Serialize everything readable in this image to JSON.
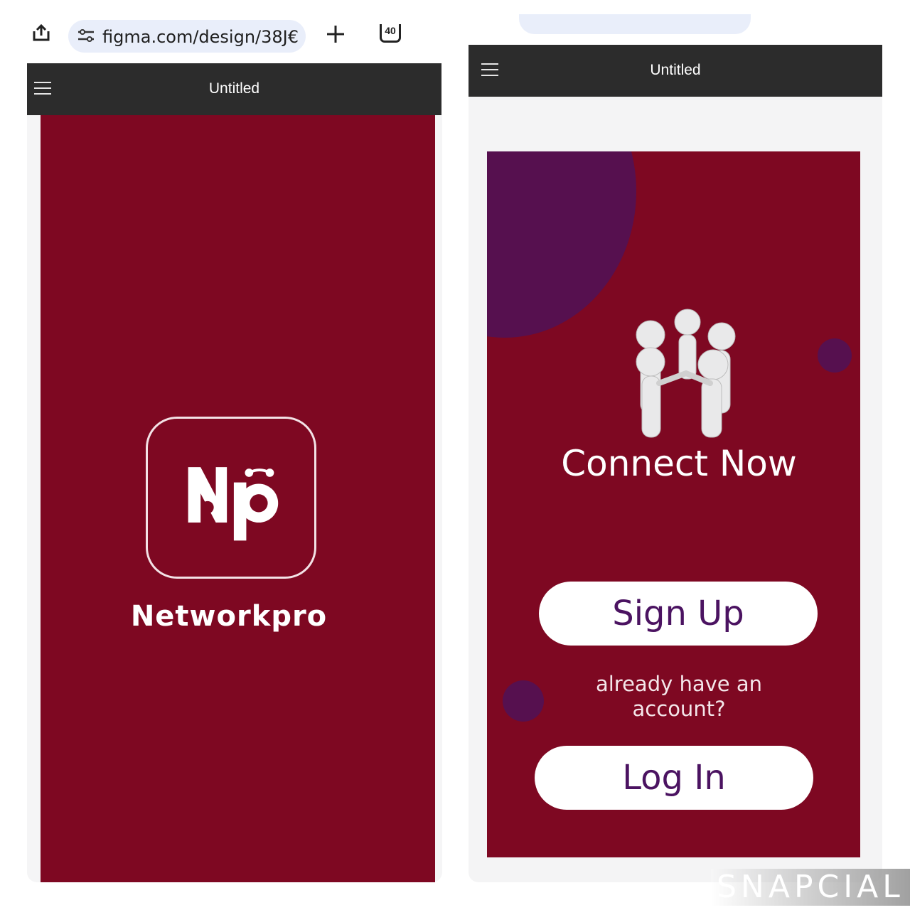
{
  "browser": {
    "url": "figma.com/design/38J€",
    "tab_count": "40"
  },
  "left_screen": {
    "title": "Untitled",
    "logo_text": "Np",
    "app_name": "Networkpro",
    "colors": {
      "background": "#7e0822",
      "title_bar": "#2c2c2c"
    }
  },
  "right_screen": {
    "title": "Untitled",
    "headline": "Connect Now",
    "sign_up_label": "Sign Up",
    "helper_text_line1": "already have an",
    "helper_text_line2": "account?",
    "log_in_label": "Log In",
    "colors": {
      "background": "#7e0822",
      "accent": "#56104f",
      "button_text": "#4b1361"
    }
  },
  "watermark": "SNAPCIAL"
}
